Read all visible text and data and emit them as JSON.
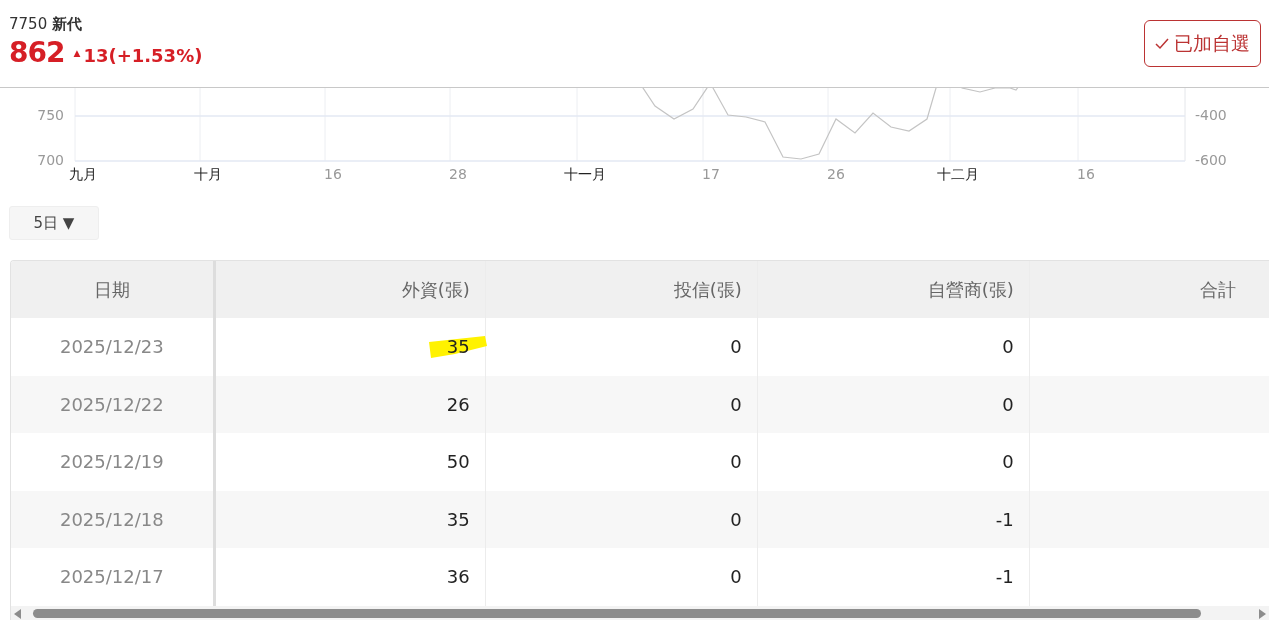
{
  "header": {
    "code": "7750",
    "name": "新代",
    "price": "862",
    "change_arrow": "▲",
    "change": "13(+1.53%)",
    "watch_button": {
      "label": "已加自選",
      "checked": true
    }
  },
  "chart": {
    "y_left_labels": [
      "750",
      "700"
    ],
    "y_right_labels": [
      "-400",
      "-600"
    ],
    "x_labels": [
      {
        "label": "九月",
        "kind": "month"
      },
      {
        "label": "十月",
        "kind": "month"
      },
      {
        "label": "16",
        "kind": "day"
      },
      {
        "label": "28",
        "kind": "day"
      },
      {
        "label": "十一月",
        "kind": "month"
      },
      {
        "label": "17",
        "kind": "day"
      },
      {
        "label": "26",
        "kind": "day"
      },
      {
        "label": "十二月",
        "kind": "month"
      },
      {
        "label": "16",
        "kind": "day"
      }
    ]
  },
  "period_dropdown": {
    "value": "5日",
    "caret": "▼"
  },
  "table": {
    "columns": [
      "日期",
      "外資(張)",
      "投信(張)",
      "自營商(張)",
      "合計"
    ],
    "rows": [
      {
        "cells": [
          "2025/12/23",
          "35",
          "0",
          "0"
        ],
        "highlighted": true
      },
      {
        "cells": [
          "2025/12/22",
          "26",
          "0",
          "0"
        ],
        "highlighted": false
      },
      {
        "cells": [
          "2025/12/19",
          "50",
          "0",
          "0"
        ],
        "highlighted": false
      },
      {
        "cells": [
          "2025/12/18",
          "35",
          "0",
          "-1"
        ],
        "highlighted": false
      },
      {
        "cells": [
          "2025/12/17",
          "36",
          "0",
          "-1"
        ],
        "highlighted": false
      }
    ]
  }
}
